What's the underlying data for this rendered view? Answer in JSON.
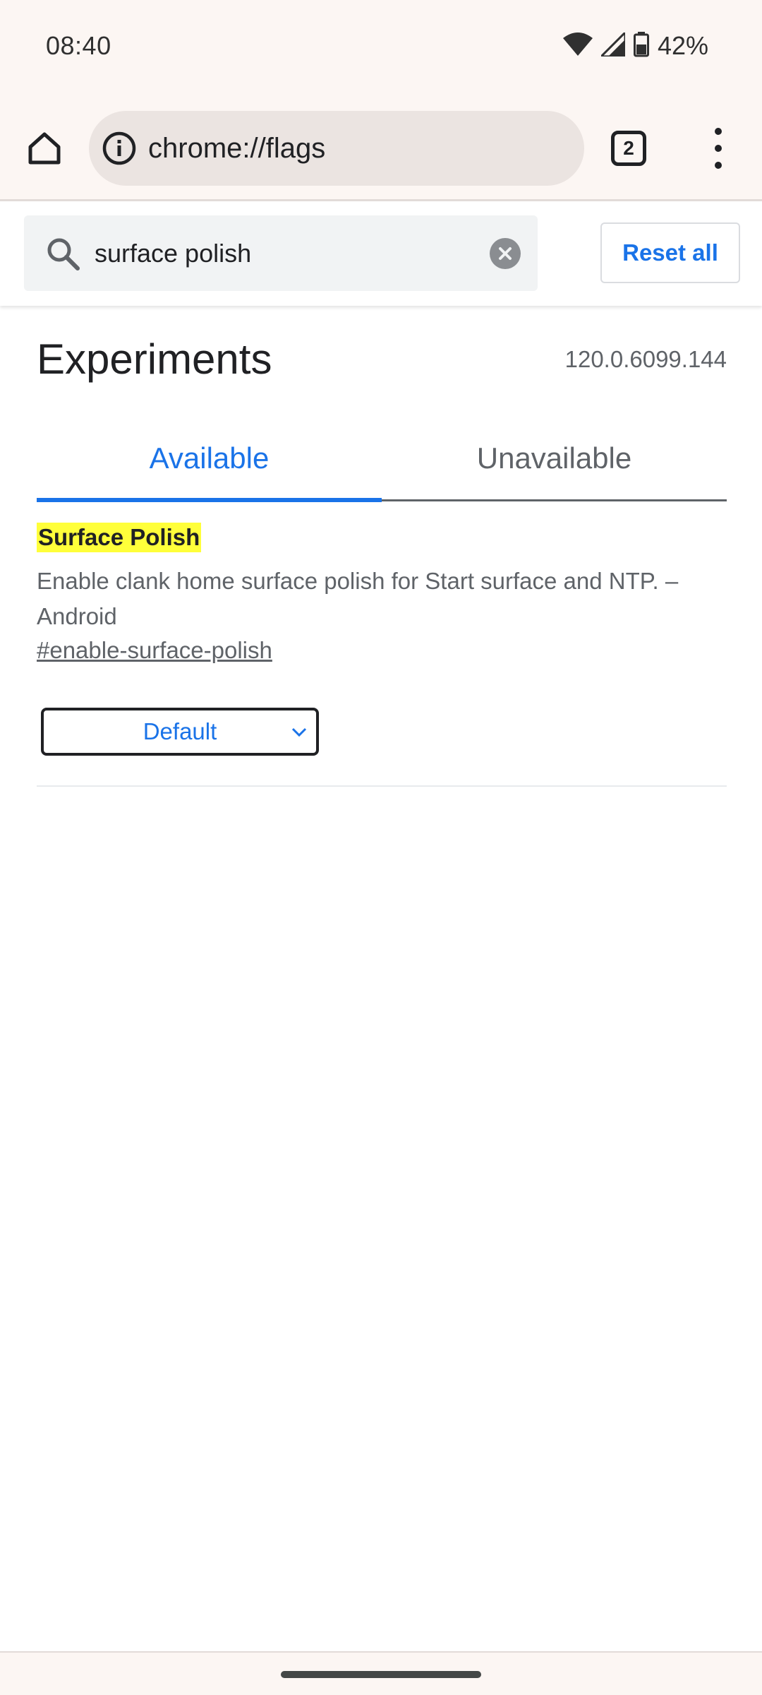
{
  "status_bar": {
    "time": "08:40",
    "battery": "42%",
    "icons": [
      "wifi-icon",
      "signal-icon",
      "battery-icon"
    ]
  },
  "toolbar": {
    "url": "chrome://flags",
    "tab_count": "2",
    "icons": [
      "home-icon",
      "info-icon",
      "overflow-menu-icon"
    ]
  },
  "search": {
    "value": "surface polish",
    "placeholder": "Search flags",
    "reset_label": "Reset all"
  },
  "page": {
    "title": "Experiments",
    "version": "120.0.6099.144",
    "tabs": [
      {
        "label": "Available",
        "active": true
      },
      {
        "label": "Unavailable",
        "active": false
      }
    ]
  },
  "experiment": {
    "title": "Surface Polish",
    "description": "Enable clank home surface polish for Start surface and NTP. – Android",
    "link": "#enable-surface-polish",
    "selected_option": "Default"
  },
  "colors": {
    "accent": "#1a73e8",
    "highlight": "#ffff3a",
    "chrome_bg": "#fcf6f3"
  }
}
